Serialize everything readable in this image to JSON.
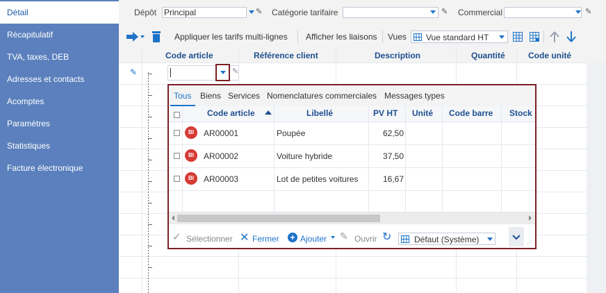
{
  "sidebar": {
    "items": [
      {
        "label": "Détail"
      },
      {
        "label": "Récapitulatif"
      },
      {
        "label": "TVA, taxes, DEB"
      },
      {
        "label": "Adresses et contacts"
      },
      {
        "label": "Acomptes"
      },
      {
        "label": "Paramètres"
      },
      {
        "label": "Statistiques"
      },
      {
        "label": "Facture électronique"
      }
    ]
  },
  "filters": {
    "depot_label": "Dépôt",
    "depot_value": "Principal",
    "categorie_label": "Catégorie tarifaire",
    "categorie_value": "",
    "commercial_label": "Commercial",
    "commercial_value": ""
  },
  "toolbar": {
    "apply_label": "Appliquer les tarifs multi-lignes",
    "links_label": "Afficher les liaisons",
    "views_label": "Vues",
    "view_value": "Vue standard HT"
  },
  "grid": {
    "columns": [
      "Code article",
      "Référence client",
      "Description",
      "Quantité",
      "Code unité"
    ]
  },
  "popup": {
    "tabs": [
      "Tous",
      "Biens",
      "Services",
      "Nomenclatures commerciales",
      "Messages types"
    ],
    "columns": [
      "Code article",
      "Libellé",
      "PV HT",
      "Unité",
      "Code barre",
      "Stock"
    ],
    "rows": [
      {
        "badge": "BI",
        "code": "AR00001",
        "libelle": "Poupée",
        "pv": "62,50"
      },
      {
        "badge": "BI",
        "code": "AR00002",
        "libelle": "Voiture hybride",
        "pv": "37,50"
      },
      {
        "badge": "BI",
        "code": "AR00003",
        "libelle": "Lot de petites voitures",
        "pv": "16,67"
      }
    ],
    "footer": {
      "select_label": "Sélectionner",
      "close_label": "Fermer",
      "add_label": "Ajouter",
      "open_label": "Ouvrir",
      "layout_value": "Défaut (Système)"
    }
  },
  "colors": {
    "sidebar_bg": "#5b80bd",
    "accent": "#1e73c9",
    "highlight_border": "#7b1f24",
    "badge": "#d63a34"
  }
}
